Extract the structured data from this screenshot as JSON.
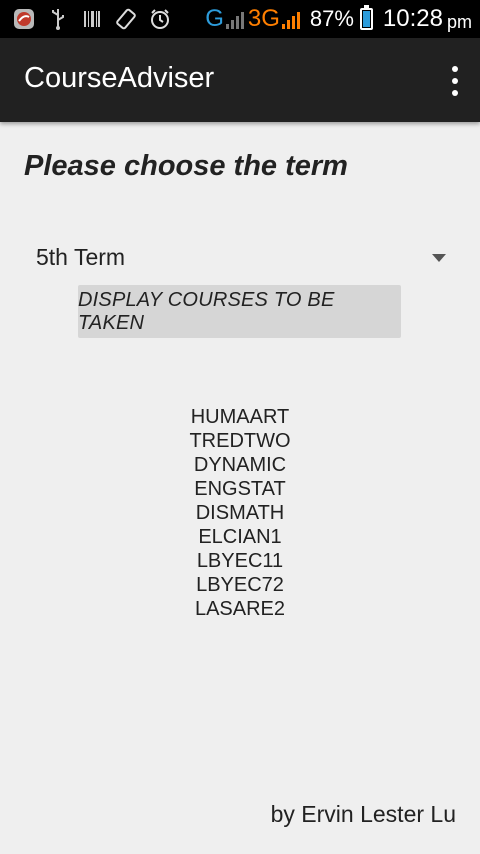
{
  "status_bar": {
    "icons": [
      "notification-app-icon",
      "usb-icon",
      "barcode-icon",
      "screen-rotate-icon",
      "alarm-icon"
    ],
    "network_g": "G",
    "network_3g": "3G",
    "battery_percent": "87%",
    "battery_level": 0.87,
    "time": "10:28",
    "ampm": "pm"
  },
  "app_bar": {
    "title": "CourseAdviser",
    "overflow_icon": "more-vert-icon"
  },
  "main": {
    "heading": "Please choose the term",
    "term_spinner": {
      "selected": "5th Term"
    },
    "display_button": "DISPLAY COURSES TO BE TAKEN",
    "courses": [
      "HUMAART",
      "TREDTWO",
      "DYNAMIC",
      "ENGSTAT",
      "DISMATH",
      "ELCIAN1",
      "LBYEC11",
      "LBYEC72",
      "LASARE2"
    ],
    "credit": "by Ervin Lester Lu"
  },
  "colors": {
    "status_bar_bg": "#000000",
    "app_bar_bg": "#212121",
    "background": "#efefef",
    "network_blue": "#2d9cdb",
    "network_orange": "#ff7f00"
  }
}
